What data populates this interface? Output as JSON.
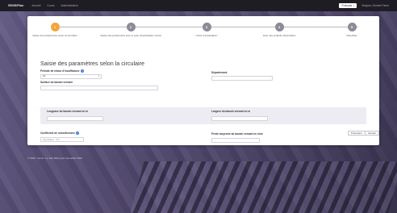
{
  "topbar": {
    "brand": "SENSIPlan",
    "nav": [
      "Accueil",
      "Cours",
      "Administration"
    ],
    "language": "Français",
    "user": "Bonjour, Ahmed Fares"
  },
  "steps": [
    {
      "number": "1",
      "label": "Saisie des paramètres selon la circulaire",
      "active": true
    },
    {
      "number": "2",
      "label": "Saisie des paramètres pour le type d'exploitation choisi",
      "active": false
    },
    {
      "number": "3",
      "label": "Choix d'exploitation",
      "active": false
    },
    {
      "number": "4",
      "label": "Liste des produits disponibles",
      "active": false
    },
    {
      "number": "5",
      "label": "Résultats",
      "active": false
    }
  ],
  "form": {
    "title": "Saisie des paramètres selon la circulaire",
    "periode_label": "Période de retour d'insuffisance",
    "periode_value": "10",
    "departement_label": "Département",
    "departement_value": "",
    "surface_label": "Surface du bassin versant",
    "surface_value": "",
    "longueur_label": "Longueur du bassin versant en m",
    "longueur_value": "",
    "largeur_label": "Largeur du bassin versant en m",
    "largeur_value": "",
    "coefficient_label": "Coefficient de ruissellement",
    "coefficient_placeholder": "Par défaut : 0,5",
    "pente_label": "Pente moyenne du bassin versant en m/m",
    "pente_value": ""
  },
  "buttons": {
    "previous": "Précédent",
    "next": "Suivant"
  },
  "footer": {
    "text": "© 2020 - Sensi - Le Site Web pour vous aider 2020"
  },
  "colors": {
    "active_step": "#f4a53a",
    "inactive_step": "#8d8b97",
    "info_icon": "#3d7bd8"
  }
}
